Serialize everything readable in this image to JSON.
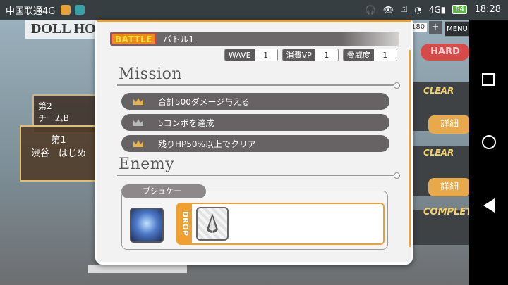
{
  "status_bar": {
    "carrier": "中国联通4G",
    "network": "4G",
    "battery": "64",
    "time": "18:28"
  },
  "background": {
    "title": "DOLL HO",
    "card1": "第2\nチームB",
    "card2_line1": "第1",
    "card2_line2": "渋谷　はじめ",
    "count": "180",
    "plus": "+",
    "menu": "MENU",
    "hard": "HARD",
    "clear1": "CLEAR",
    "clear2": "CLEAR",
    "detail1": "詳細",
    "detail2": "詳細",
    "complete": "COMPLETE"
  },
  "dialog": {
    "battle_tag": "BATTLE",
    "battle_name": "バトル1",
    "stats": [
      {
        "label": "WAVE",
        "value": "1"
      },
      {
        "label": "消費VP",
        "value": "1"
      },
      {
        "label": "脅威度",
        "value": "1"
      }
    ],
    "mission_title": "Mission",
    "missions": [
      {
        "text": "合計500ダメージ与える",
        "crown_color": "#e8b54a"
      },
      {
        "text": "5コンボを達成",
        "crown_color": "#b8b8b8"
      },
      {
        "text": "残りHP50%以上でクリア",
        "crown_color": "#e8b54a"
      }
    ],
    "enemy_title": "Enemy",
    "enemy_name": "ブシュケー",
    "drop_label": "DROP"
  },
  "colors": {
    "accent": "#f0a030",
    "pill": "#676364"
  }
}
